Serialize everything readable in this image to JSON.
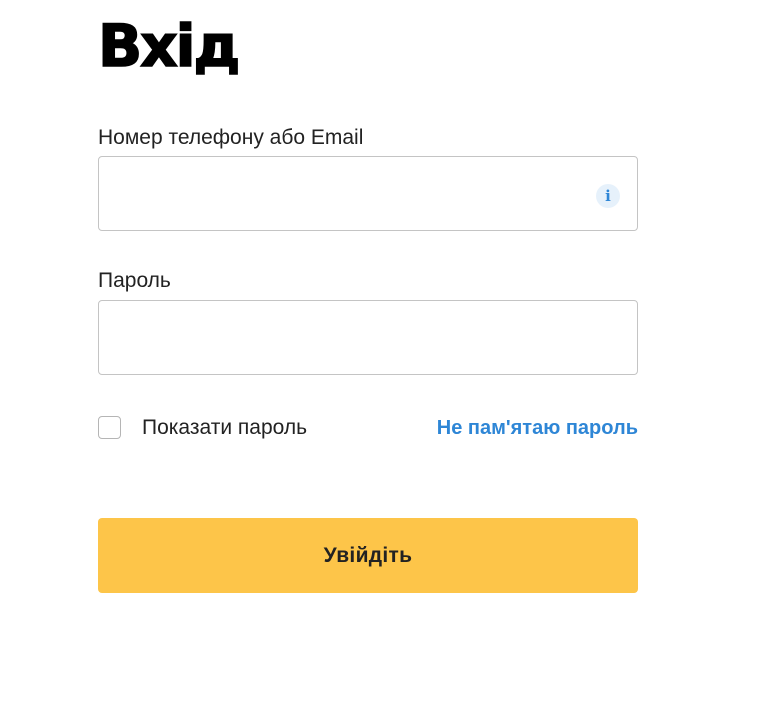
{
  "page": {
    "title": "Вхід"
  },
  "login_field": {
    "label": "Номер телефону або Email",
    "value": "",
    "info_icon": "info-icon"
  },
  "password_field": {
    "label": "Пароль",
    "value": ""
  },
  "show_password": {
    "label": "Показати пароль",
    "checked": false
  },
  "forgot_password": {
    "label": "Не пам'ятаю пароль"
  },
  "submit": {
    "label": "Увійдіть"
  },
  "colors": {
    "accent_button": "#fdc549",
    "link": "#2e86d6",
    "info_icon": "#2e86d6",
    "border": "#c4c4c4"
  }
}
